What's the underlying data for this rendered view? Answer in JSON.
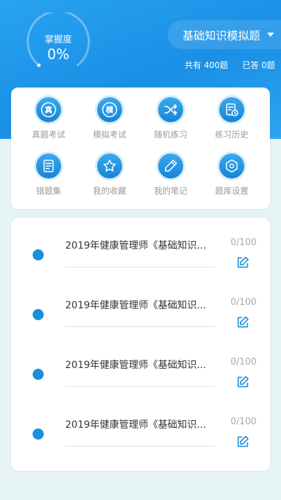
{
  "mastery": {
    "label": "掌握度",
    "value": "0%",
    "fraction": 0
  },
  "bank": {
    "name": "基础知识模拟题",
    "dropdown_icon": "caret-down-icon"
  },
  "stats": {
    "total": "共有 400题",
    "answered": "已答 0题"
  },
  "features": [
    {
      "label": "真题考试",
      "icon": "real-exam-icon",
      "glyph": "真"
    },
    {
      "label": "模拟考试",
      "icon": "mock-exam-icon",
      "glyph": "模"
    },
    {
      "label": "随机练习",
      "icon": "shuffle-icon"
    },
    {
      "label": "练习历史",
      "icon": "history-icon"
    },
    {
      "label": "错题集",
      "icon": "wrong-questions-icon"
    },
    {
      "label": "我的收藏",
      "icon": "star-icon"
    },
    {
      "label": "我的笔记",
      "icon": "pencil-icon"
    },
    {
      "label": "题库设置",
      "icon": "settings-icon"
    }
  ],
  "papers": [
    {
      "title": "2019年健康管理师《基础知识...",
      "progress": "0/100"
    },
    {
      "title": "2019年健康管理师《基础知识...",
      "progress": "0/100"
    },
    {
      "title": "2019年健康管理师《基础知识...",
      "progress": "0/100"
    },
    {
      "title": "2019年健康管理师《基础知识...",
      "progress": "0/100"
    }
  ],
  "colors": {
    "primary": "#1a8fe6",
    "accent_dot": "#1a8fdc",
    "background": "#e7f4f5"
  }
}
